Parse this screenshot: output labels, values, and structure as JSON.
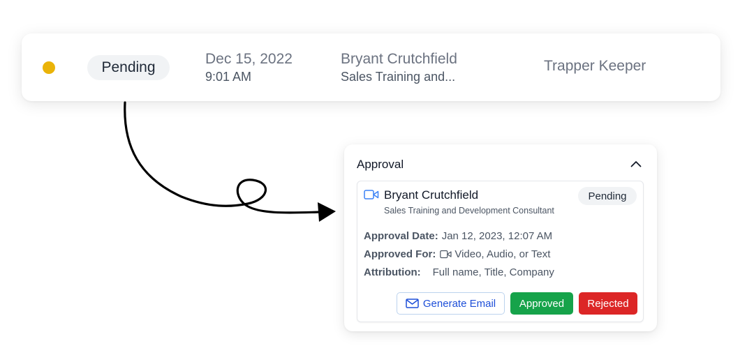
{
  "row": {
    "status_label": "Pending",
    "date": "Dec 15, 2022",
    "time": "9:01 AM",
    "person_name": "Bryant Crutchfield",
    "person_title_truncated": "Sales Training and...",
    "organization": "Trapper Keeper"
  },
  "approval": {
    "title": "Approval",
    "reviewer_name": "Bryant Crutchfield",
    "reviewer_title": "Sales Training and Development Consultant",
    "status_label": "Pending",
    "approval_date_label": "Approval Date:",
    "approval_date_value": "Jan 12, 2023, 12:07 AM",
    "approved_for_label": "Approved For:",
    "approved_for_value": "Video, Audio, or Text",
    "attribution_label": "Attribution:",
    "attribution_value": "Full name, Title, Company",
    "buttons": {
      "generate_email": "Generate Email",
      "approved": "Approved",
      "rejected": "Rejected"
    }
  },
  "colors": {
    "pending_dot": "#eab308",
    "approved": "#16a34a",
    "rejected": "#dc2626",
    "link_blue": "#1d4ed8",
    "icon_blue": "#3b82f6"
  },
  "icons": {
    "status": "status-dot",
    "collapse": "chevron-up-icon",
    "media": "video-camera-icon",
    "email": "envelope-icon"
  }
}
